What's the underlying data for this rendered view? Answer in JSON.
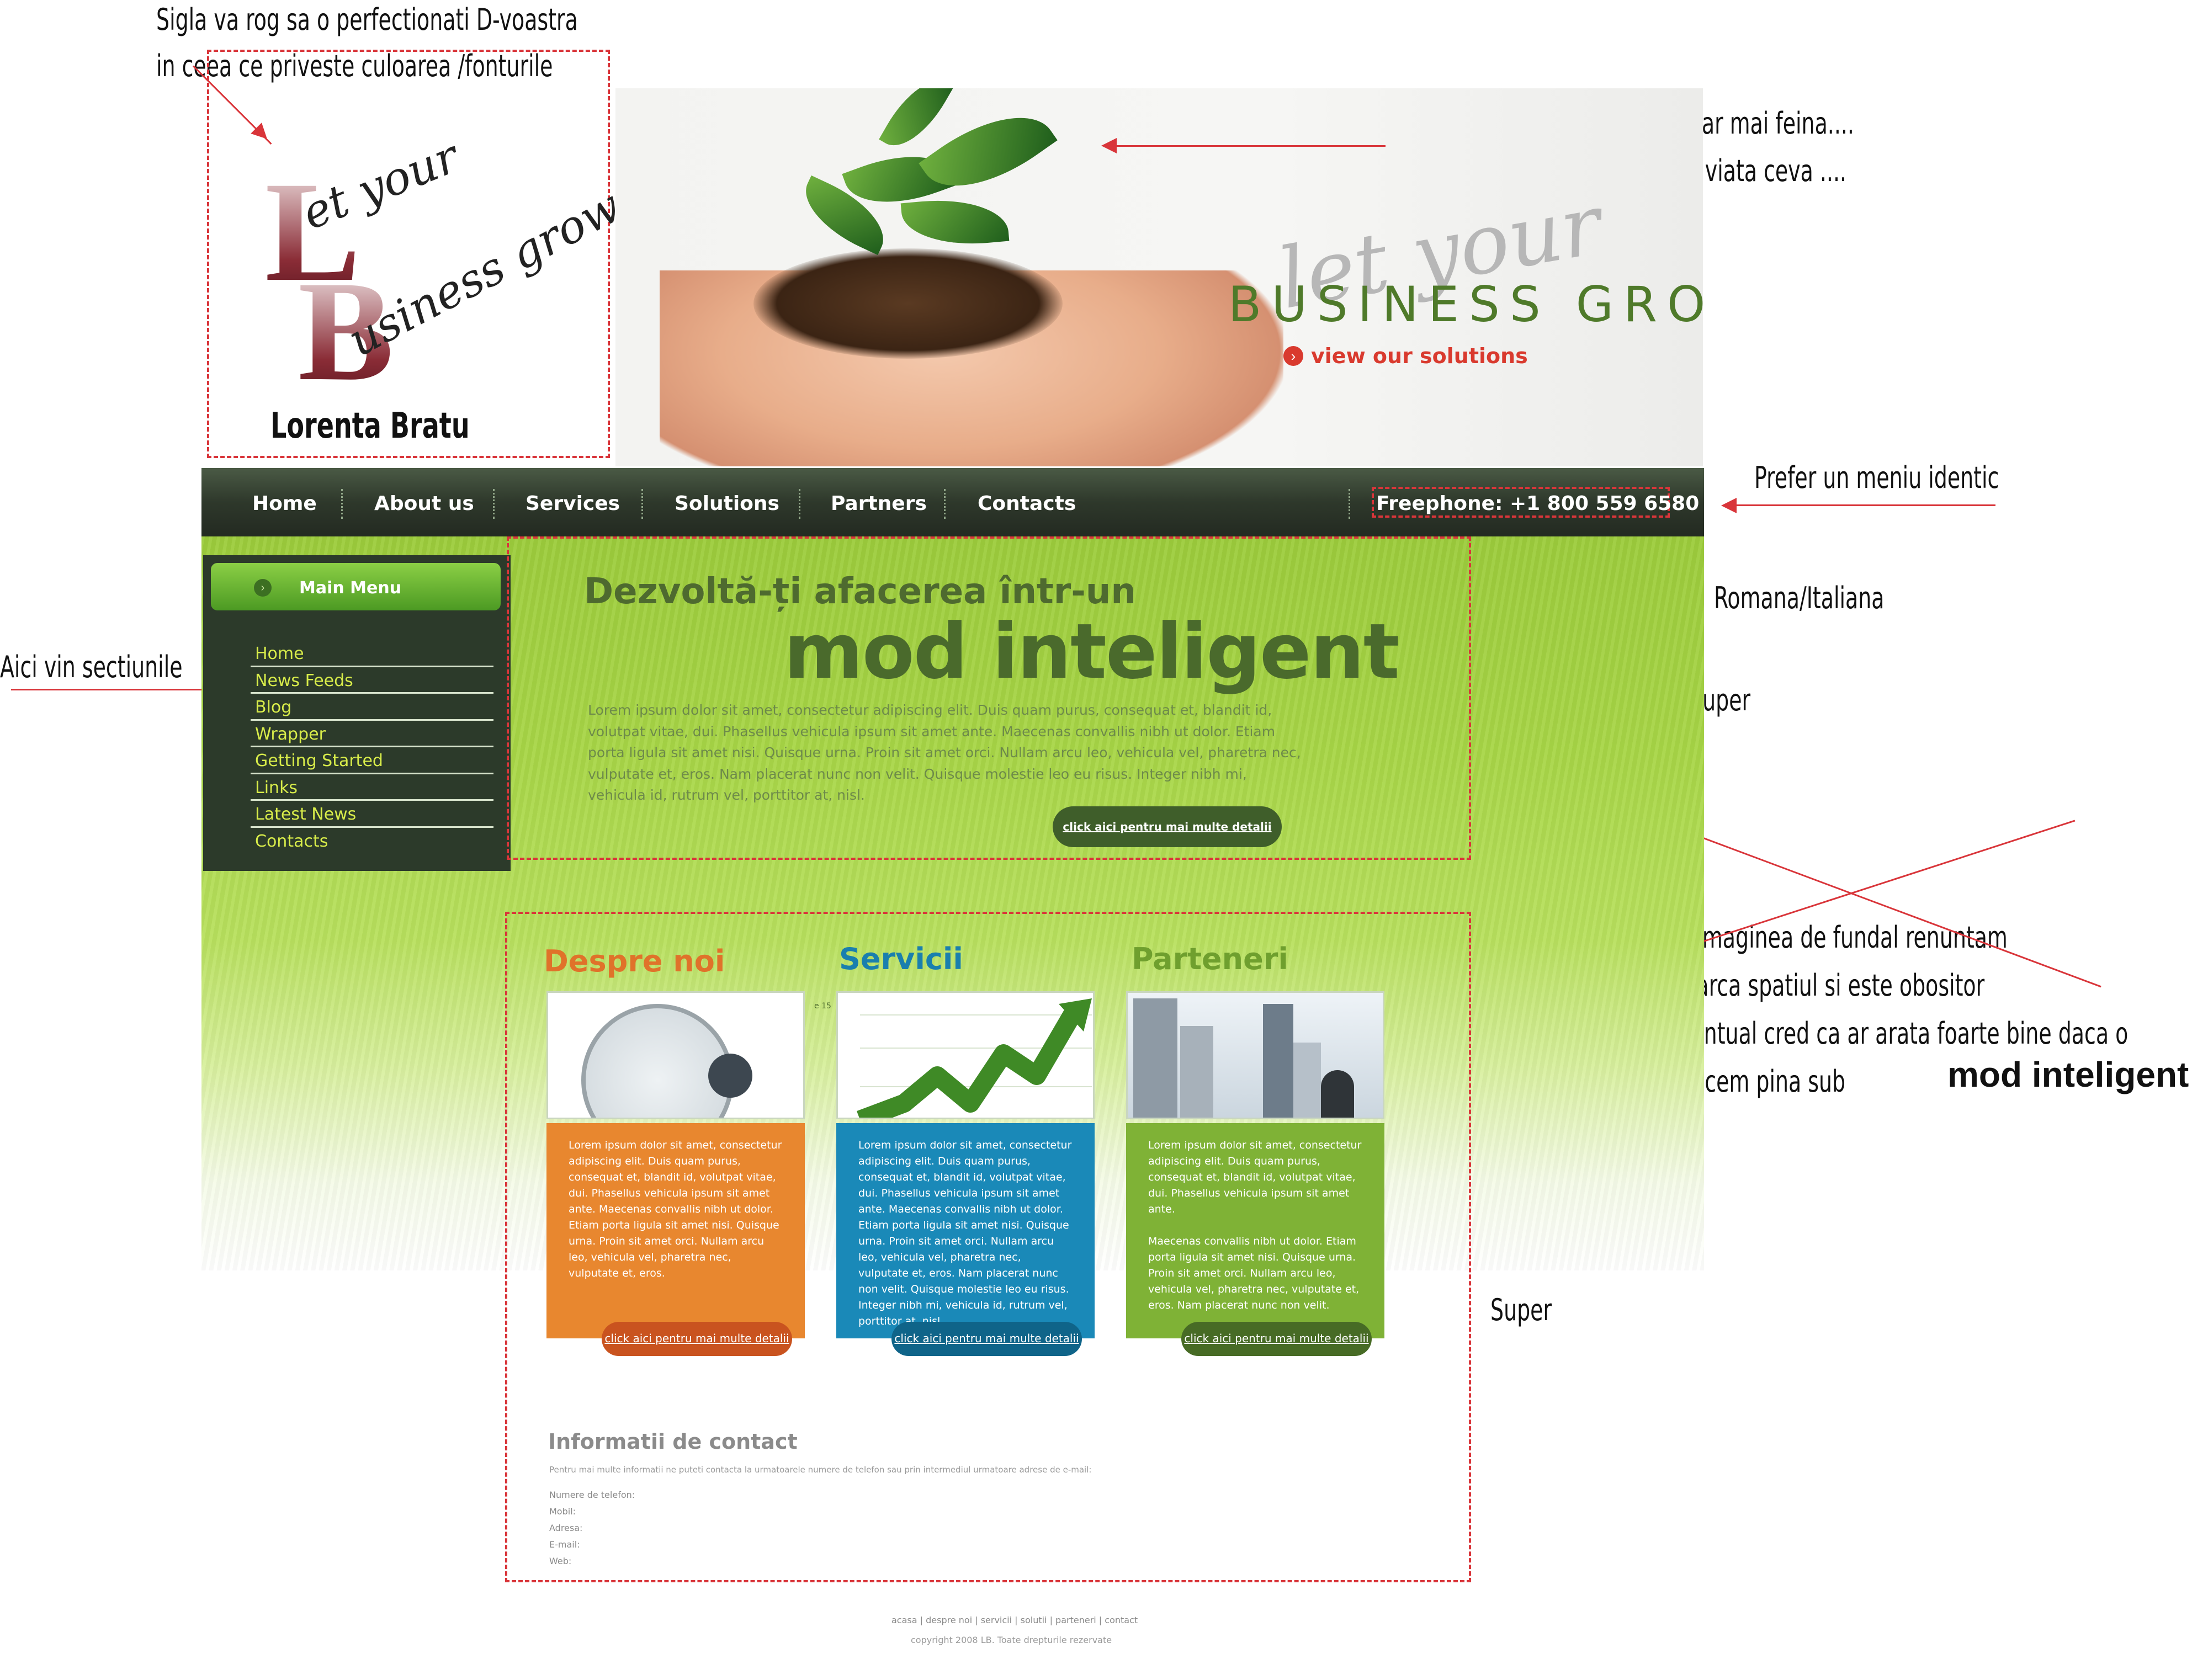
{
  "notes": {
    "logo_note_line1": "Sigla va rog sa o perfectionati D-voastra",
    "logo_note_line2": "in ceea ce priveste culoarea /fonturile",
    "hero_note_line1": "Prefer imaginea aceasta sau una foarte apropiata, chiar mai feina....",
    "hero_note_line2": "din considerentul : in mina unei tipe creste/ se prinde viata ceva ....",
    "menu_note": "Prefer un meniu identic",
    "lang_note": "Romana/Italiana",
    "message_note": "Amplasare mesaj - Super",
    "sections_note": "Aici vin sectiunile",
    "bg_note_line1": "La imaginea de fundal renuntam",
    "bg_note_line2": "incarca spatiul si este obositor",
    "bg_note_line3": "Eventual cred ca ar arata foarte bine daca o",
    "bg_note_line4": "aducem pina sub",
    "bg_note_bold": "mod inteligent",
    "columns_note": "Super"
  },
  "logo": {
    "letter_l": "L",
    "letter_b": "B",
    "script_line1": "et your",
    "script_line2": "usiness grow",
    "name": "Lorenta Bratu"
  },
  "hero": {
    "script": "let your",
    "title": "BUSINESS GROW",
    "link": "view our solutions"
  },
  "nav": {
    "items": [
      "Home",
      "About us",
      "Services",
      "Solutions",
      "Partners",
      "Contacts"
    ],
    "phone": "Freephone:  +1 800 559 6580"
  },
  "sidebar": {
    "title": "Main Menu",
    "items": [
      "Home",
      "News Feeds",
      "Blog",
      "Wrapper",
      "Getting Started",
      "Links",
      "Latest News",
      "Contacts"
    ]
  },
  "message": {
    "top": "Dezvoltă-ți afacerea într-un",
    "big": "mod inteligent",
    "body": "Lorem ipsum dolor sit amet, consectetur adipiscing elit. Duis quam purus, consequat et, blandit id, volutpat vitae, dui. Phasellus vehicula ipsum sit amet ante. Maecenas convallis nibh ut dolor. Etiam porta ligula sit amet nisi. Quisque urna. Proin sit amet orci. Nullam arcu leo, vehicula vel, pharetra nec, vulputate et, eros. Nam placerat nunc non velit. Quisque molestie leo eu risus. Integer nibh mi, vehicula id, rutrum vel, porttitor at, nisl.",
    "button": "click aici pentru mai multe detalii"
  },
  "columns": [
    {
      "title": "Despre noi",
      "text": "Lorem ipsum dolor sit amet, consectetur adipiscing elit. Duis quam purus, consequat et, blandit id, volutpat vitae, dui. Phasellus vehicula ipsum sit amet ante. Maecenas convallis nibh ut dolor. Etiam porta ligula sit amet nisi. Quisque urna. Proin sit amet orci. Nullam arcu leo, vehicula vel, pharetra nec, vulputate et, eros.",
      "button": "click aici pentru mai multe detalii",
      "color": "#e8872f"
    },
    {
      "title": "Servicii",
      "text": "Lorem ipsum dolor sit amet, consectetur adipiscing elit. Duis quam purus, consequat et, blandit id, volutpat vitae, dui. Phasellus vehicula ipsum sit amet ante. Maecenas convallis nibh ut dolor. Etiam porta ligula sit amet nisi. Quisque urna. Proin sit amet orci. Nullam arcu leo, vehicula vel, pharetra nec, vulputate et, eros. Nam placerat nunc non velit. Quisque molestie leo eu risus. Integer nibh mi, vehicula id, rutrum vel, porttitor at, nisl.",
      "button": "click aici pentru mai multe detalii",
      "color": "#1a89b8"
    },
    {
      "title": "Parteneri",
      "text": "Lorem ipsum dolor sit amet, consectetur adipiscing elit. Duis quam purus, consequat et, blandit id, volutpat vitae, dui. Phasellus vehicula ipsum sit amet ante.",
      "text2": "Maecenas convallis nibh ut dolor. Etiam porta ligula sit amet nisi. Quisque urna. Proin sit amet orci. Nullam arcu leo, vehicula vel, pharetra nec, vulputate et, eros. Nam placerat nunc non velit.",
      "button": "click aici pentru mai multe detalii",
      "color": "#7fb236"
    }
  ],
  "chart_labels": {
    "left": "e 15"
  },
  "contact": {
    "title": "Informatii de contact",
    "intro": "Pentru mai multe informatii ne puteti contacta la urmatoarele numere de telefon sau prin intermediul urmatoare adrese de e-mail:",
    "fields": [
      "Numere de telefon:",
      "Mobil:",
      "Adresa:",
      "E-mail:",
      "Web:"
    ]
  },
  "footer": {
    "links": "acasa | despre noi | servicii | solutii | parteneri | contact",
    "copyright": "copyright 2008 LB. Toate drepturile rezervate"
  },
  "colors": {
    "nav_bg": "#2e382b",
    "accent_green": "#4a6a2c",
    "annotation_red": "#d9353a",
    "sidebar_link": "#d8ec4a"
  }
}
